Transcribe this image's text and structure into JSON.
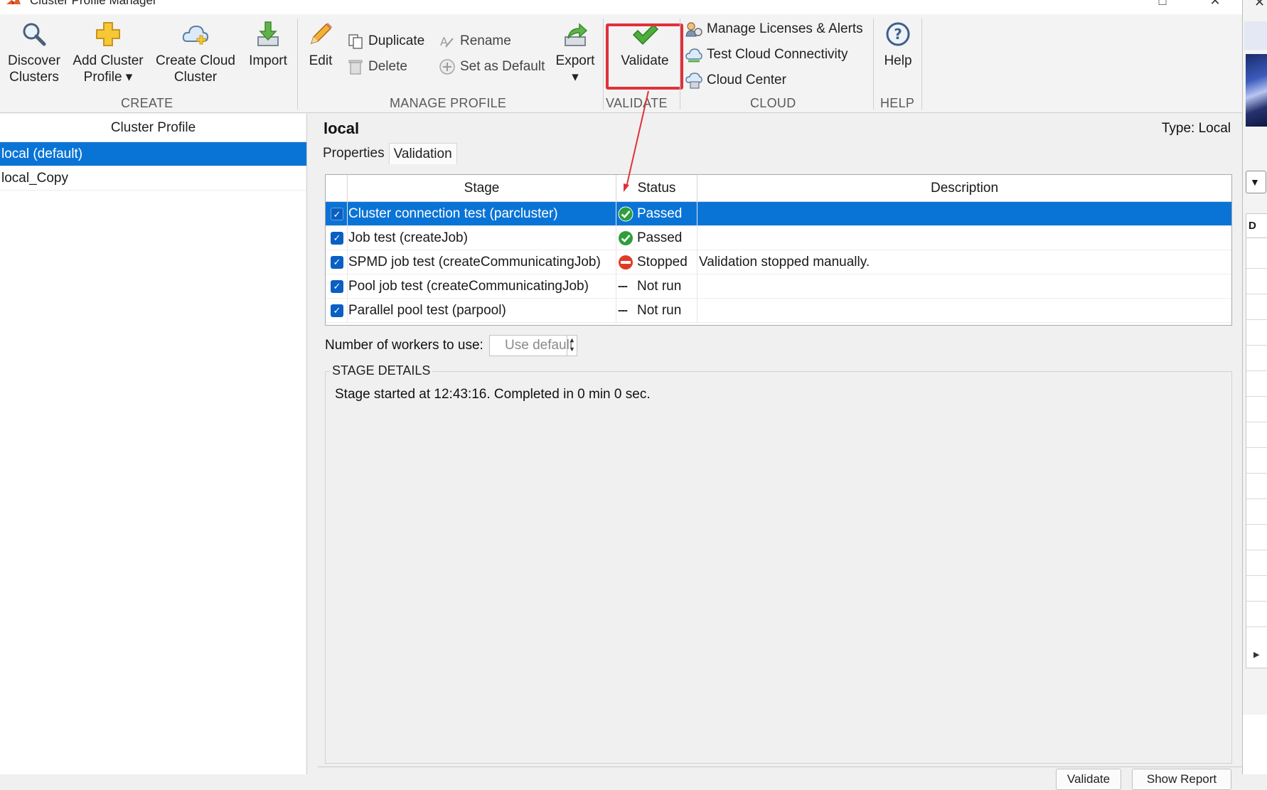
{
  "window": {
    "title": "Cluster Profile Manager",
    "icons": {
      "app": "matlab-logo-icon",
      "maximize": "maximize-icon",
      "close": "close-icon"
    }
  },
  "toolstrip": {
    "create": {
      "section_label": "CREATE",
      "discover": {
        "label": "Discover\nClusters",
        "icon": "magnifier-icon"
      },
      "add_profile": {
        "label": "Add Cluster\nProfile ▾",
        "icon": "plus-icon"
      },
      "create_cloud": {
        "label": "Create Cloud\nCluster",
        "icon": "cloud-plus-icon"
      },
      "import": {
        "label": "Import",
        "icon": "import-arrow-icon"
      }
    },
    "manage": {
      "section_label": "MANAGE PROFILE",
      "edit": {
        "label": "Edit",
        "icon": "pencil-icon"
      },
      "duplicate": {
        "label": "Duplicate",
        "icon": "duplicate-icon"
      },
      "delete": {
        "label": "Delete",
        "icon": "trash-icon"
      },
      "rename": {
        "label": "Rename",
        "icon": "rename-icon"
      },
      "set_default": {
        "label": "Set as Default",
        "icon": "plus-circle-icon"
      },
      "export": {
        "label": "Export\n▾",
        "icon": "export-arrow-icon"
      }
    },
    "validate": {
      "section_label": "VALIDATE",
      "validate": {
        "label": "Validate",
        "icon": "checkmark-icon"
      }
    },
    "cloud": {
      "section_label": "CLOUD",
      "manage_licenses": {
        "label": "Manage Licenses & Alerts",
        "icon": "license-icon"
      },
      "test_cloud": {
        "label": "Test Cloud Connectivity",
        "icon": "cloud-connectivity-icon"
      },
      "cloud_center": {
        "label": "Cloud Center",
        "icon": "cloud-center-icon"
      }
    },
    "help": {
      "section_label": "HELP",
      "help": {
        "label": "Help",
        "icon": "help-icon"
      }
    }
  },
  "profiles_panel": {
    "header": "Cluster Profile",
    "items": [
      {
        "label": "local (default)",
        "selected": true
      },
      {
        "label": "local_Copy",
        "selected": false
      }
    ]
  },
  "detail": {
    "name": "local",
    "type": "Type: Local",
    "tabs": [
      {
        "label": "Properties",
        "active": false
      },
      {
        "label": "Validation",
        "active": true
      }
    ],
    "table": {
      "columns": [
        "Stage",
        "Status",
        "Description"
      ],
      "rows": [
        {
          "checked": true,
          "stage": "Cluster connection test (parcluster)",
          "status": "Passed",
          "status_icon": "passed-check-icon",
          "description": "",
          "selected": true
        },
        {
          "checked": true,
          "stage": "Job test (createJob)",
          "status": "Passed",
          "status_icon": "passed-check-icon",
          "description": "",
          "selected": false
        },
        {
          "checked": true,
          "stage": "SPMD job test (createCommunicatingJob)",
          "status": "Stopped",
          "status_icon": "stop-sign-icon",
          "description": "Validation stopped manually.",
          "selected": false
        },
        {
          "checked": true,
          "stage": "Pool job test (createCommunicatingJob)",
          "status": "Not run",
          "status_icon": "not-run-dash-icon",
          "description": "",
          "selected": false
        },
        {
          "checked": true,
          "stage": "Parallel pool test (parpool)",
          "status": "Not run",
          "status_icon": "not-run-dash-icon",
          "description": "",
          "selected": false
        }
      ]
    },
    "workers": {
      "label": "Number of workers to use:",
      "placeholder": "Use default"
    },
    "stage_details": {
      "title": "STAGE DETAILS",
      "text": "Stage started at 12:43:16.  Completed in 0 min 0 sec."
    },
    "footer_buttons": [
      "Validate",
      "Show Report"
    ]
  },
  "colors": {
    "selection": "#0a74d6",
    "highlight_annotation": "#e0313a",
    "passed": "#2e9e3a",
    "stopped": "#e03b24"
  },
  "background_window": {
    "header_letter": "D"
  }
}
